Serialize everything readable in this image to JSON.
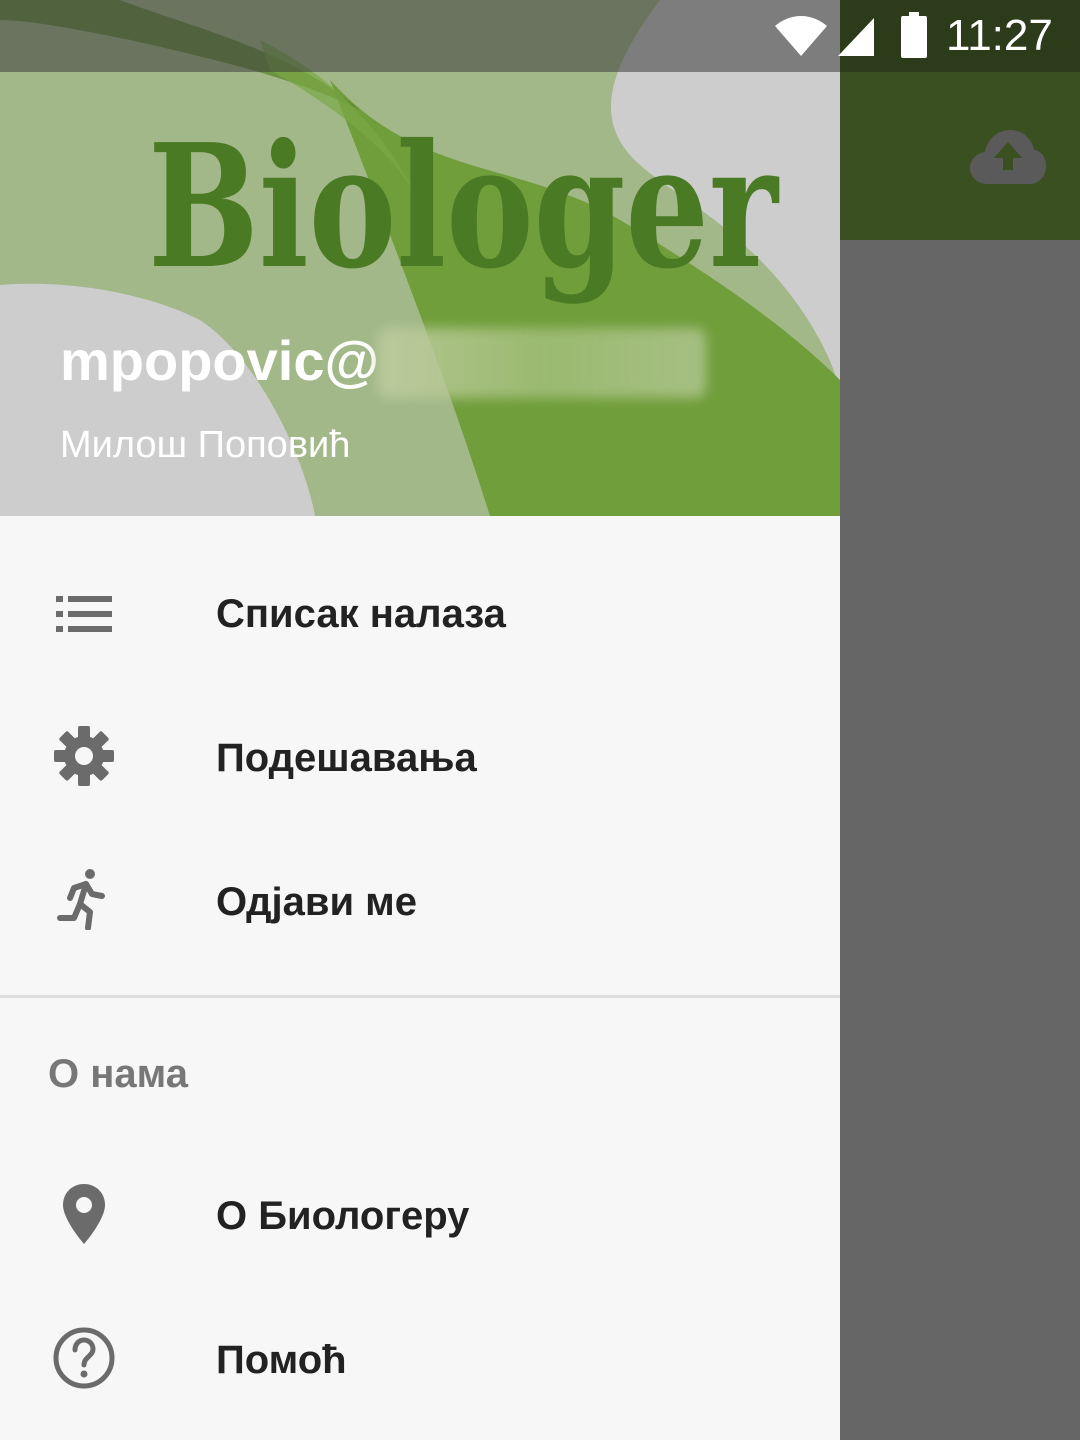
{
  "status_bar": {
    "time": "11:27",
    "icons": [
      "wifi-icon",
      "cell-signal-icon",
      "battery-icon"
    ]
  },
  "app_toolbar": {
    "action_icon": "cloud-upload-icon"
  },
  "drawer": {
    "header": {
      "logo_text": "Biologer",
      "email": "mpopovic@",
      "name": "Милош Поповић"
    },
    "menu_items": [
      {
        "label": "Списак налаза",
        "icon": "list-icon"
      },
      {
        "label": "Подешавања",
        "icon": "gear-icon"
      },
      {
        "label": "Одјави ме",
        "icon": "run-icon"
      }
    ],
    "section_title": "О нама",
    "about_items": [
      {
        "label": "О Биологеру",
        "icon": "location-pin-icon"
      },
      {
        "label": "Помоћ",
        "icon": "help-circle-icon"
      }
    ]
  },
  "colors": {
    "toolbar": "#3a5020",
    "header_green": "#6f9e3a",
    "logo_green": "#4b7a24",
    "scrim": "#666666"
  }
}
